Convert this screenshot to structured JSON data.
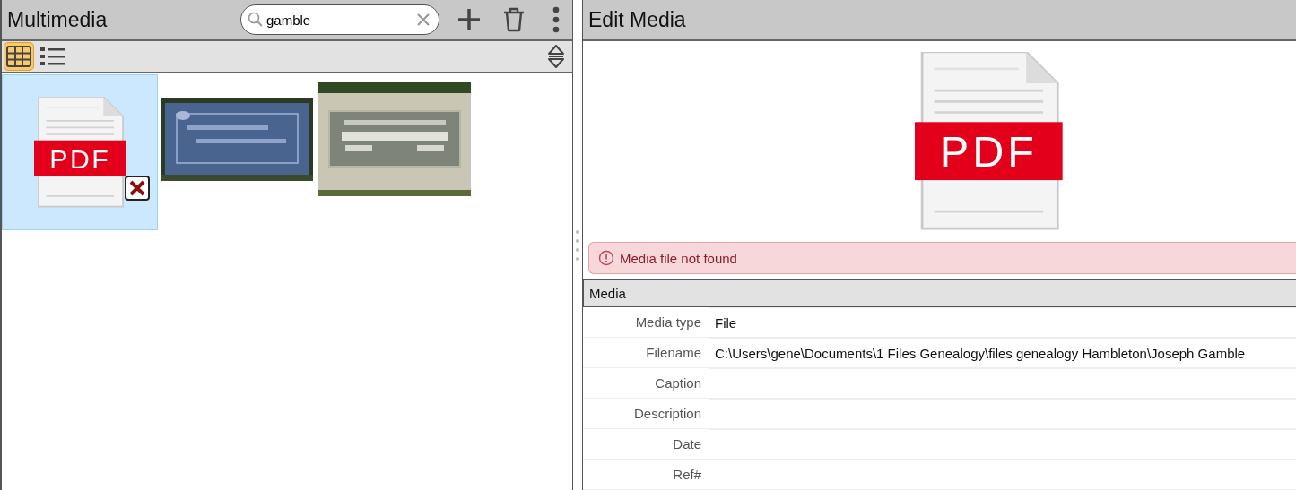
{
  "left_panel": {
    "title": "Multimedia",
    "search": {
      "value": "gamble"
    },
    "view_modes": [
      {
        "kind": "grid",
        "selected": true
      },
      {
        "kind": "list",
        "selected": false
      }
    ],
    "items": [
      {
        "kind": "pdf",
        "label": "PDF",
        "selected": true,
        "missing": true
      },
      {
        "kind": "picture",
        "selected": false
      },
      {
        "kind": "picture",
        "selected": false
      }
    ]
  },
  "right_panel": {
    "title": "Edit Media",
    "preview": {
      "label": "PDF"
    },
    "alert": "Media file not found",
    "section": "Media",
    "fields": [
      {
        "label": "Media type",
        "value": "File"
      },
      {
        "label": "Filename",
        "value": "C:\\Users\\gene\\Documents\\1 Files Genealogy\\files genealogy Hambleton\\Joseph Gamble"
      },
      {
        "label": "Caption"
      },
      {
        "label": "Description"
      },
      {
        "label": "Date"
      },
      {
        "label": "Ref#"
      }
    ]
  }
}
